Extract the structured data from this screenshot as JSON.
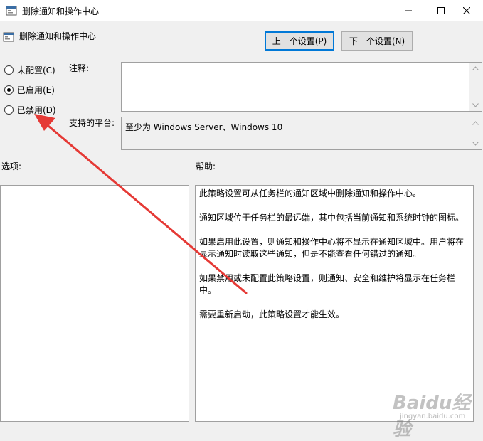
{
  "window": {
    "title": "删除通知和操作中心",
    "min_icon": "minimize-icon",
    "max_icon": "maximize-icon",
    "close_icon": "close-icon"
  },
  "header": {
    "title": "删除通知和操作中心",
    "icon": "policy-setting-icon",
    "prev_button": "上一个设置(P)",
    "next_button": "下一个设置(N)"
  },
  "radios": [
    {
      "label": "未配置(C)",
      "checked": false
    },
    {
      "label": "已启用(E)",
      "checked": true
    },
    {
      "label": "已禁用(D)",
      "checked": false
    }
  ],
  "labels": {
    "comment": "注释:",
    "platform": "支持的平台:",
    "options": "选项:",
    "help": "帮助:"
  },
  "comment_value": "",
  "platform_value": "至少为 Windows Server、Windows 10",
  "help_paragraphs": [
    "此策略设置可从任务栏的通知区域中删除通知和操作中心。",
    "通知区域位于任务栏的最远端，其中包括当前通知和系统时钟的图标。",
    "如果启用此设置，则通知和操作中心将不显示在通知区域中。用户将在显示通知时读取这些通知，但是不能查看任何错过的通知。",
    "如果禁用或未配置此策略设置，则通知、安全和维护将显示在任务栏中。",
    "需要重新启动，此策略设置才能生效。"
  ],
  "watermark": {
    "main": "Baidu经验",
    "sub": "jingyan.baidu.com"
  },
  "colors": {
    "accent": "#0078d7",
    "annotation_arrow": "#e53935"
  }
}
